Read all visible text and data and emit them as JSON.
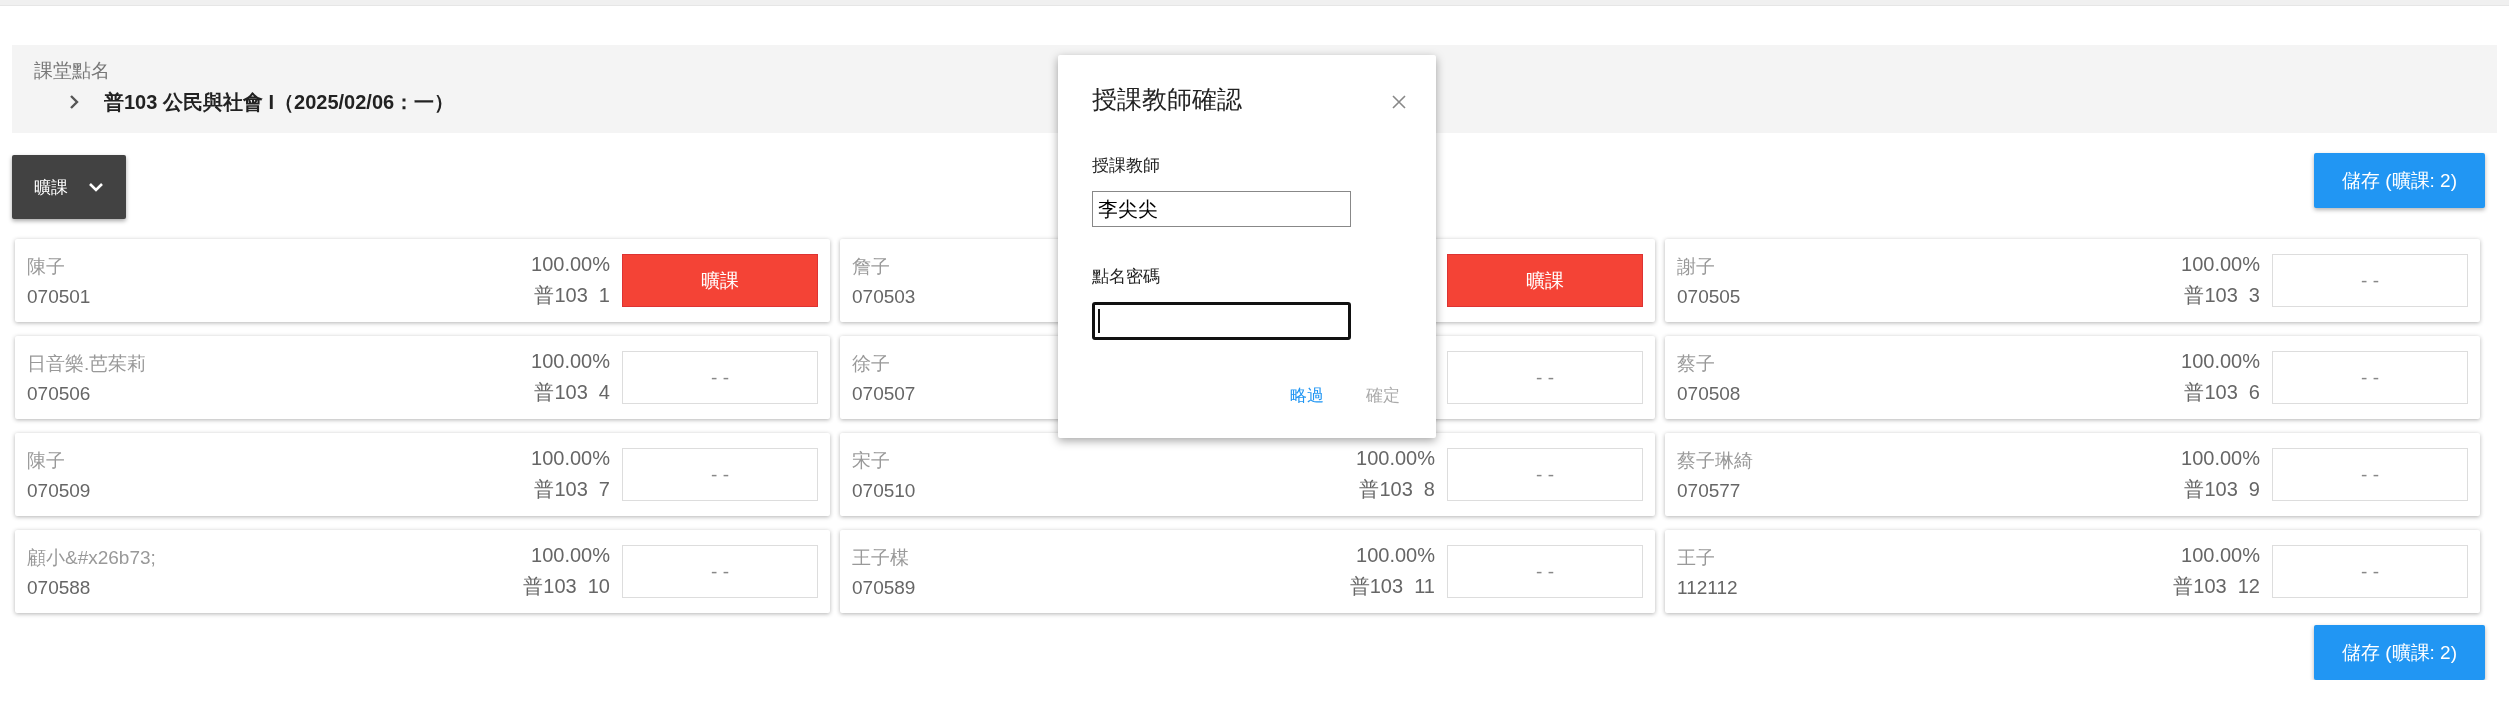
{
  "header": {
    "title": "課堂點名",
    "course": "普103 公民與社會 I（2025/02/06：一）"
  },
  "filter_button": {
    "label": "曠課"
  },
  "save_buttons": [
    {
      "label": "儲存 (曠課: 2)"
    },
    {
      "label": "儲存 (曠課: 2)"
    }
  ],
  "students": [
    {
      "name": "陳子",
      "id": "070501",
      "rate": "100.00%",
      "seat": "普103  1",
      "status": {
        "kind": "absent",
        "label": "曠課"
      }
    },
    {
      "name": "詹子",
      "id": "070503",
      "status": {
        "kind": "absent",
        "label": "曠課"
      }
    },
    {
      "name": "謝子",
      "id": "070505",
      "rate": "100.00%",
      "seat": "普103  3",
      "status": {
        "kind": "none",
        "label": "- -"
      }
    },
    {
      "name": "日音樂.芭茱莉",
      "id": "070506",
      "rate": "100.00%",
      "seat": "普103  4",
      "status": {
        "kind": "none",
        "label": "- -"
      }
    },
    {
      "name": "徐子",
      "id": "070507",
      "status": {
        "kind": "none",
        "label": "- -"
      }
    },
    {
      "name": "蔡子",
      "id": "070508",
      "rate": "100.00%",
      "seat": "普103  6",
      "status": {
        "kind": "none",
        "label": "- -"
      }
    },
    {
      "name": "陳子",
      "id": "070509",
      "rate": "100.00%",
      "seat": "普103  7",
      "status": {
        "kind": "none",
        "label": "- -"
      }
    },
    {
      "name": "宋子",
      "id": "070510",
      "rate": "100.00%",
      "seat": "普103  8",
      "status": {
        "kind": "none",
        "label": "- -"
      }
    },
    {
      "name": "蔡子琳綺",
      "id": "070577",
      "rate": "100.00%",
      "seat": "普103  9",
      "status": {
        "kind": "none",
        "label": "- -"
      }
    },
    {
      "name": "顧小&#x26b73;",
      "id": "070588",
      "rate": "100.00%",
      "seat": "普103  10",
      "status": {
        "kind": "none",
        "label": "- -"
      }
    },
    {
      "name": "王子楳",
      "id": "070589",
      "rate": "100.00%",
      "seat": "普103  11",
      "status": {
        "kind": "none",
        "label": "- -"
      }
    },
    {
      "name": "王子",
      "id": "112112",
      "rate": "100.00%",
      "seat": "普103  12",
      "status": {
        "kind": "none",
        "label": "- -"
      }
    }
  ],
  "dialog": {
    "title": "授課教師確認",
    "teacher_label": "授課教師",
    "teacher_value": "李尖尖",
    "password_label": "點名密碼",
    "skip_button": "略過",
    "confirm_button": {
      "label": "確定",
      "disabled": true
    }
  }
}
